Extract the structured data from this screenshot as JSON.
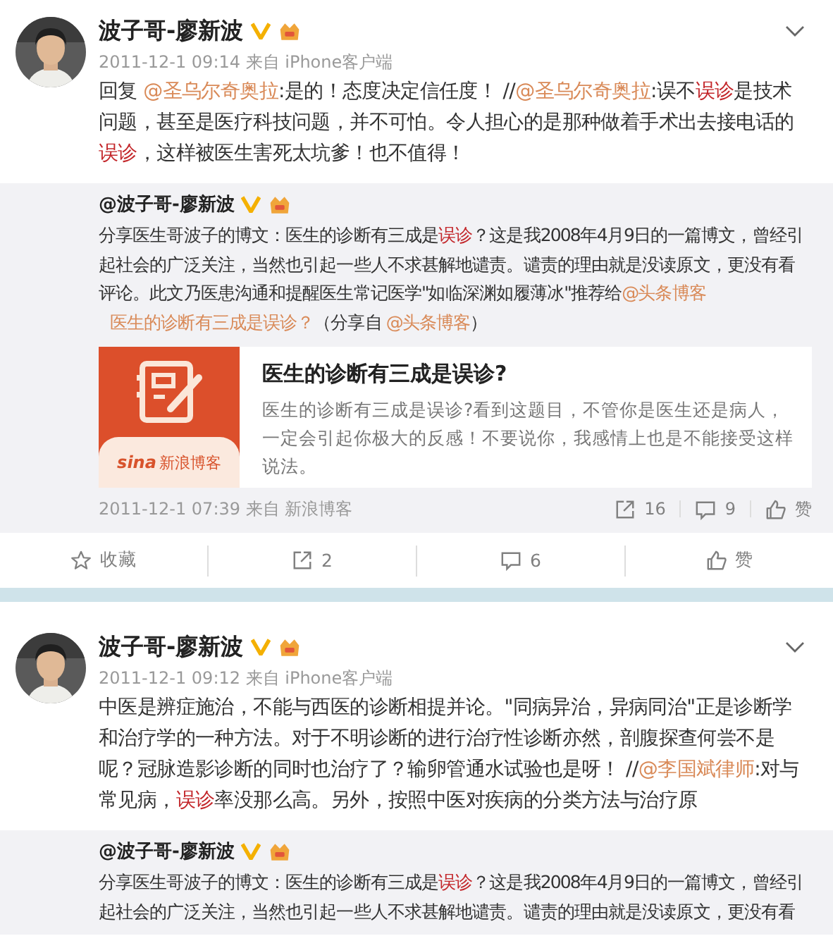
{
  "posts": [
    {
      "author": "波子哥-廖新波",
      "meta": "2011-12-1 09:14 来自 iPhone客户端",
      "text": [
        {
          "kind": "text",
          "text": "回复 "
        },
        {
          "kind": "mention",
          "text": "@圣乌尔奇奥拉"
        },
        {
          "kind": "text",
          "text": ":是的！态度决定信任度！ //"
        },
        {
          "kind": "mention",
          "text": "@圣乌尔奇奥拉"
        },
        {
          "kind": "text",
          "text": ":误不"
        },
        {
          "kind": "keyword",
          "text": "误诊"
        },
        {
          "kind": "text",
          "text": "是技术问题，甚至是医疗科技问题，并不可怕。令人担心的是那种做着手术出去接电话的"
        },
        {
          "kind": "keyword",
          "text": "误诊"
        },
        {
          "kind": "text",
          "text": "，这样被医生害死太坑爹！也不值得！"
        }
      ],
      "repost": {
        "author": "@波子哥-廖新波",
        "text": [
          {
            "kind": "text",
            "text": "分享医生哥波子的博文：医生的诊断有三成是"
          },
          {
            "kind": "keyword",
            "text": "误诊"
          },
          {
            "kind": "text",
            "text": "？这是我2008年4月9日的一篇博文，曾经引起社会的广泛关注，当然也引起一些人不求甚解地谴责。谴责的理由就是没读原文，更没有看评论。此文乃医患沟通和提醒医生常记医学\"如临深渊如履薄冰\"推荐给"
          },
          {
            "kind": "mention",
            "text": "@头条博客"
          },
          {
            "kind": "link",
            "text": "医生的诊断有三成是误诊？"
          },
          {
            "kind": "text",
            "text": "（分享自 "
          },
          {
            "kind": "mention",
            "text": "@头条博客"
          },
          {
            "kind": "text",
            "text": "）"
          }
        ],
        "card": {
          "logo": [
            "sina",
            "新浪博客"
          ],
          "title": "医生的诊断有三成是误诊?",
          "description": "医生的诊断有三成是误诊?看到这题目，不管你是医生还是病人，一定会引起你极大的反感！不要说你，我感情上也是不能接受这样说法。"
        },
        "meta": "2011-12-1 07:39 来自 新浪博客",
        "actions": [
          {
            "kind": "share",
            "label": "16"
          },
          {
            "kind": "comment",
            "label": "9"
          },
          {
            "kind": "like",
            "label": "赞"
          }
        ]
      },
      "actions": [
        {
          "kind": "favorite",
          "label": "收藏"
        },
        {
          "kind": "share",
          "label": "2"
        },
        {
          "kind": "comment",
          "label": "6"
        },
        {
          "kind": "like",
          "label": "赞"
        }
      ]
    },
    {
      "author": "波子哥-廖新波",
      "meta": "2011-12-1 09:12 来自 iPhone客户端",
      "text": [
        {
          "kind": "text",
          "text": "中医是辨症施治，不能与西医的诊断相提并论。\"同病异治，异病同治\"正是诊断学和治疗学的一种方法。对于不明诊断的进行治疗性诊断亦然，剖腹探查何尝不是呢？冠脉造影诊断的同时也治疗了？输卵管通水试验也是呀！ //"
        },
        {
          "kind": "mention",
          "text": "@李国斌律师"
        },
        {
          "kind": "text",
          "text": ":对与常见病，"
        },
        {
          "kind": "keyword",
          "text": "误诊"
        },
        {
          "kind": "text",
          "text": "率没那么高。另外，按照中医对疾病的分类方法与治疗原"
        }
      ],
      "repost": {
        "author": "@波子哥-廖新波",
        "text": [
          {
            "kind": "text",
            "text": "分享医生哥波子的博文：医生的诊断有三成是"
          },
          {
            "kind": "keyword",
            "text": "误诊"
          },
          {
            "kind": "text",
            "text": "？这是我2008年4月9日的一篇博文，曾经引起社会的广泛关注，当然也引起一些人不求甚解地谴责。谴责的理由就是没读原文，更没有看"
          }
        ]
      }
    }
  ]
}
